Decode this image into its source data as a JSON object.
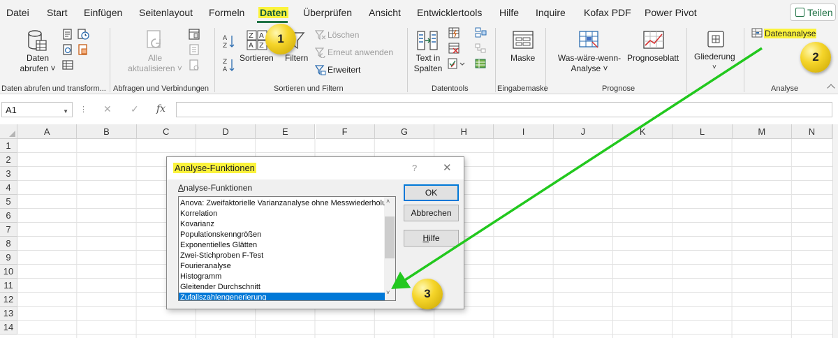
{
  "menu": {
    "items": [
      "Datei",
      "Start",
      "Einfügen",
      "Seitenlayout",
      "Formeln",
      "Daten",
      "Überprüfen",
      "Ansicht",
      "Entwicklertools",
      "Hilfe",
      "Inquire",
      "Kofax PDF",
      "Power Pivot"
    ],
    "active": "Daten",
    "share_label": "Teilen"
  },
  "ribbon": {
    "daten_abrufen_1": "Daten",
    "daten_abrufen_2": "abrufen ˅",
    "alle_1": "Alle",
    "alle_2": "aktualisieren ˅",
    "sortieren": "Sortieren",
    "filtern": "Filtern",
    "loeschen": "Löschen",
    "erneut": "Erneut anwenden",
    "erweitert": "Erweitert",
    "text_1": "Text in",
    "text_2": "Spalten",
    "maske": "Maske",
    "waswaere_1": "Was-wäre-wenn-",
    "waswaere_2": "Analyse ˅",
    "prognoseblatt": "Prognoseblatt",
    "gliederung": "Gliederung",
    "gliederung_caret": "˅",
    "datenanalyse": "Datenanalyse",
    "groups": {
      "g1": "Daten abrufen und transform...",
      "g2": "Abfragen und Verbindungen",
      "g3": "Sortieren und Filtern",
      "g4": "Datentools",
      "g5": "Eingabemaske",
      "g6": "Prognose",
      "g7": "Analyse"
    }
  },
  "formula_bar": {
    "name_box": "A1",
    "fx": "fx",
    "cancel": "✕",
    "confirm": "✓",
    "formula": ""
  },
  "grid": {
    "columns": [
      "A",
      "B",
      "C",
      "D",
      "E",
      "F",
      "G",
      "H",
      "I",
      "J",
      "K",
      "L",
      "M",
      "N"
    ],
    "rows": [
      "1",
      "2",
      "3",
      "4",
      "5",
      "6",
      "7",
      "8",
      "9",
      "10",
      "11",
      "12",
      "13",
      "14"
    ]
  },
  "dialog": {
    "title": "Analyse-Funktionen",
    "help": "?",
    "close": "✕",
    "list_label": "Analyse-Funktionen",
    "items": [
      "Anova: Zweifaktorielle Varianzanalyse ohne Messwiederholung",
      "Korrelation",
      "Kovarianz",
      "Populationskenngrößen",
      "Exponentielles Glätten",
      "Zwei-Stichproben F-Test",
      "Fourieranalyse",
      "Histogramm",
      "Gleitender Durchschnitt",
      "Zufallszahlengenerierung"
    ],
    "selected": "Zufallszahlengenerierung",
    "ok": "OK",
    "cancel": "Abbrechen",
    "hilfe": "Hilfe"
  },
  "callouts": [
    "1",
    "2",
    "3"
  ],
  "colors": {
    "excel_green": "#217346",
    "highlight_yellow": "#fbf33c",
    "arrow_green": "#22c81e",
    "selection_blue": "#0078d7"
  }
}
